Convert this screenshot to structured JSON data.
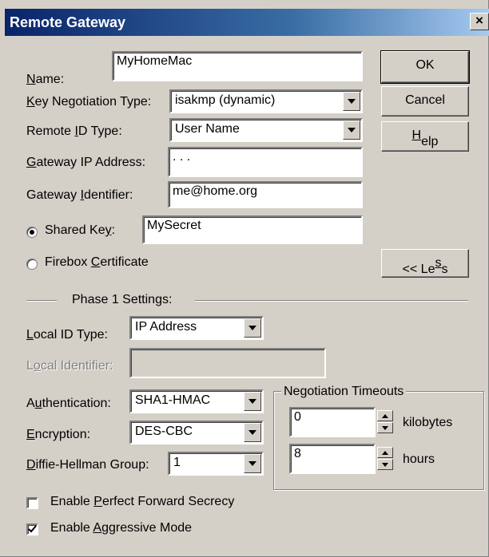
{
  "window": {
    "title": "Remote Gateway",
    "close_label": "×"
  },
  "fields": {
    "name": {
      "label_pre": "",
      "label_u": "N",
      "label_post": "ame:",
      "value": "MyHomeMac"
    },
    "key_negotiation_type": {
      "label_pre": "",
      "label_u": "K",
      "label_post": "ey Negotiation Type:",
      "value": "isakmp (dynamic)"
    },
    "remote_id_type": {
      "label_pre": "Remote ",
      "label_u": "I",
      "label_post": "D Type:",
      "value": "User Name"
    },
    "gateway_ip": {
      "label_pre": "",
      "label_u": "G",
      "label_post": "ateway IP Address:",
      "value": " .   .   ."
    },
    "gateway_identifier": {
      "label_pre": "Gateway ",
      "label_u": "I",
      "label_post": "dentifier:",
      "value": "me@home.org"
    },
    "shared_key": {
      "label_pre": "Shared Ke",
      "label_u": "y",
      "label_post": ":",
      "value": "MySecret",
      "selected": true
    },
    "firebox_certificate": {
      "label_pre": "Firebox ",
      "label_u": "C",
      "label_post": "ertificate",
      "selected": false
    }
  },
  "buttons": {
    "ok": "OK",
    "cancel": "Cancel",
    "help_pre": "",
    "help_u": "H",
    "help_post": "elp",
    "less_pre": "<< Le",
    "less_u": "s",
    "less_post": "s"
  },
  "phase1": {
    "title": "Phase 1 Settings:",
    "local_id_type": {
      "label_pre": "",
      "label_u": "L",
      "label_post": "ocal ID Type:",
      "value": "IP Address"
    },
    "local_identifier": {
      "label_pre": "L",
      "label_u": "o",
      "label_post": "cal Identifier:",
      "value": ""
    },
    "authentication": {
      "label_pre": "A",
      "label_u": "u",
      "label_post": "thentication:",
      "value": "SHA1-HMAC"
    },
    "encryption": {
      "label_pre": "",
      "label_u": "E",
      "label_post": "ncryption:",
      "value": "DES-CBC"
    },
    "dh_group": {
      "label_pre": "",
      "label_u": "D",
      "label_post": "iffie-Hellman Group:",
      "value": "1"
    },
    "negotiation_timeouts": {
      "title": "Negotiation Timeouts",
      "kilobytes_value": "0",
      "kilobytes_unit": "kilobytes",
      "hours_value": "8",
      "hours_unit": "hours"
    },
    "pfs": {
      "label_pre": "Enable ",
      "label_u": "P",
      "label_post": "erfect Forward Secrecy",
      "checked": false
    },
    "aggressive": {
      "label_pre": "Enable ",
      "label_u": "A",
      "label_post": "ggressive Mode",
      "checked": true
    }
  }
}
